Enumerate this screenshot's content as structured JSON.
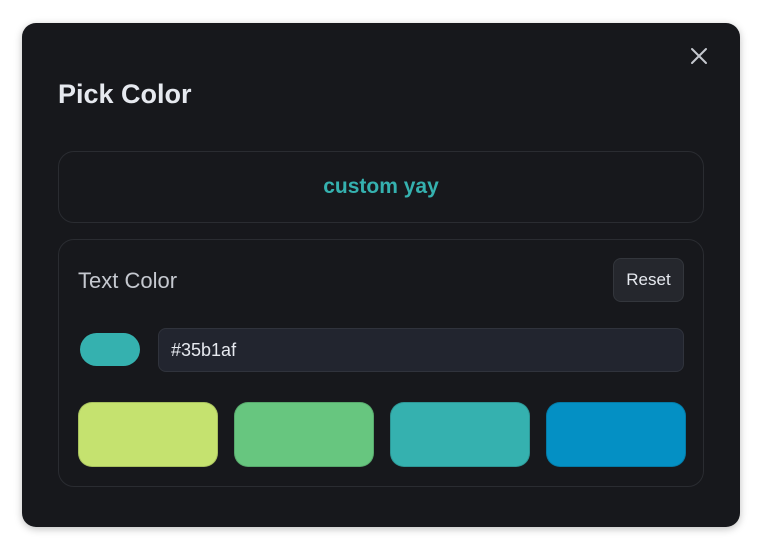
{
  "dialog": {
    "title": "Pick Color",
    "preview_text": "custom yay",
    "text_color_label": "Text Color",
    "reset_label": "Reset",
    "current_color": "#35b1af",
    "hex_value": "#35b1af",
    "presets": [
      {
        "color": "#c5e26f"
      },
      {
        "color": "#67c67f"
      },
      {
        "color": "#35b1af"
      },
      {
        "color": "#0490c4"
      }
    ],
    "close_icon": "close-icon"
  }
}
